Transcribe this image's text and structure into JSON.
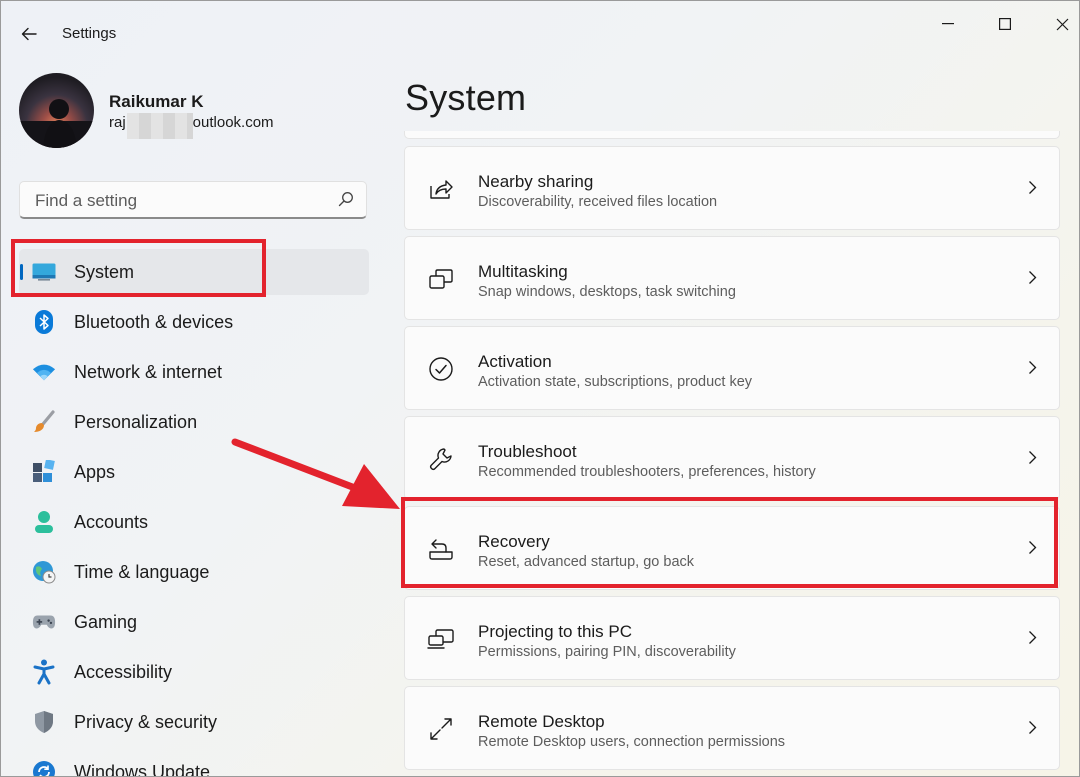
{
  "window": {
    "title": "Settings",
    "controls": [
      "minimize",
      "maximize",
      "close"
    ]
  },
  "profile": {
    "name": "Raikumar K",
    "email_visible_start": "raj",
    "email_visible_end": "outlook.com"
  },
  "search": {
    "placeholder": "Find a setting",
    "icon": "search-icon"
  },
  "sidebar": {
    "items": [
      {
        "label": "System",
        "icon": "monitor-icon",
        "selected": true
      },
      {
        "label": "Bluetooth & devices",
        "icon": "bluetooth-icon"
      },
      {
        "label": "Network & internet",
        "icon": "wifi-icon"
      },
      {
        "label": "Personalization",
        "icon": "paintbrush-icon"
      },
      {
        "label": "Apps",
        "icon": "apps-icon"
      },
      {
        "label": "Accounts",
        "icon": "person-icon"
      },
      {
        "label": "Time & language",
        "icon": "globe-clock-icon"
      },
      {
        "label": "Gaming",
        "icon": "gamepad-icon"
      },
      {
        "label": "Accessibility",
        "icon": "accessibility-icon"
      },
      {
        "label": "Privacy & security",
        "icon": "shield-icon"
      },
      {
        "label": "Windows Update",
        "icon": "update-icon"
      }
    ]
  },
  "main": {
    "title": "System",
    "cards": [
      {
        "title": "Nearby sharing",
        "desc": "Discoverability, received files location",
        "icon": "share-icon"
      },
      {
        "title": "Multitasking",
        "desc": "Snap windows, desktops, task switching",
        "icon": "multitasking-icon"
      },
      {
        "title": "Activation",
        "desc": "Activation state, subscriptions, product key",
        "icon": "check-circle-icon"
      },
      {
        "title": "Troubleshoot",
        "desc": "Recommended troubleshooters, preferences, history",
        "icon": "wrench-icon"
      },
      {
        "title": "Recovery",
        "desc": "Reset, advanced startup, go back",
        "icon": "recovery-icon",
        "highlighted": true
      },
      {
        "title": "Projecting to this PC",
        "desc": "Permissions, pairing PIN, discoverability",
        "icon": "projecting-icon"
      },
      {
        "title": "Remote Desktop",
        "desc": "Remote Desktop users, connection permissions",
        "icon": "remote-desktop-icon"
      }
    ]
  },
  "colors": {
    "accent": "#0067c0",
    "annotation": "#e3232d",
    "selected_bg": "#e5e7ea"
  }
}
